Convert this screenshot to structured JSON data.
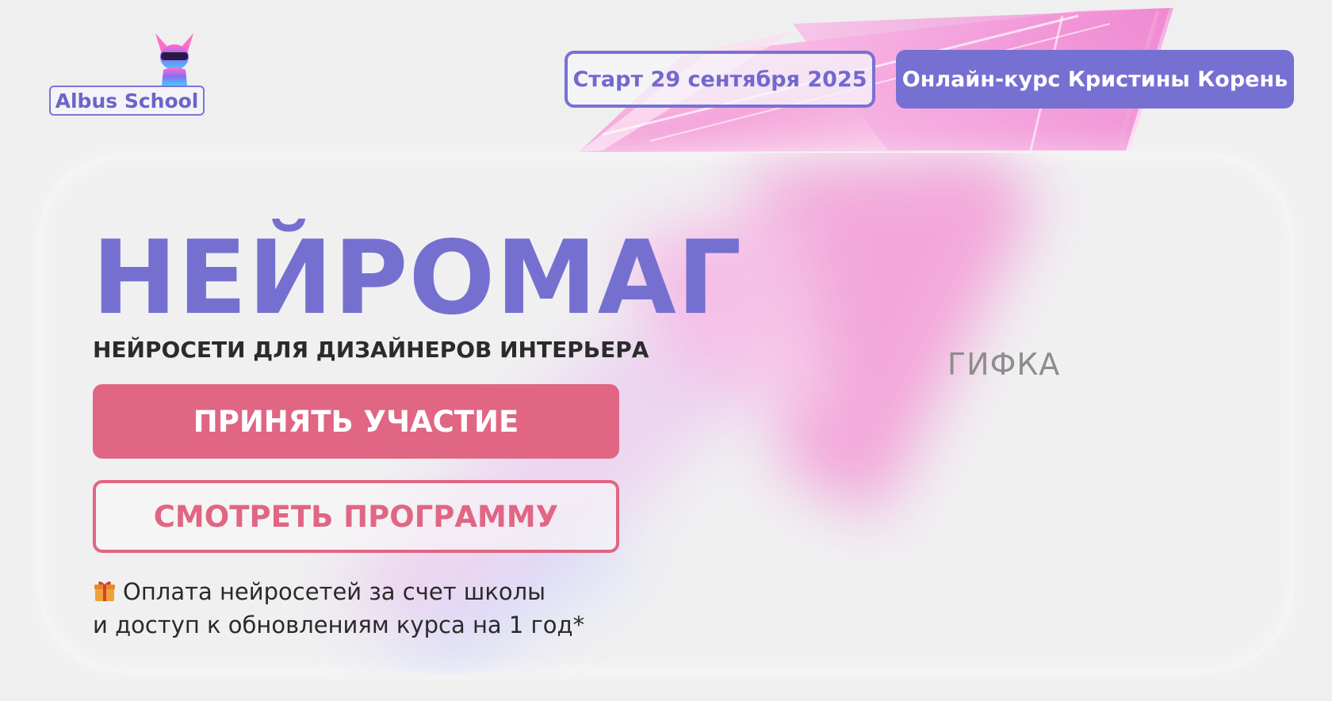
{
  "logo": {
    "text": "Albus School",
    "icon": "sphynx-cat-vr-icon"
  },
  "header": {
    "start_label": "Старт 29 сентября 2025",
    "author_label": "Онлайн-курс Кристины Корень"
  },
  "hero": {
    "title": "НЕЙРОМАГ",
    "subtitle": "НЕЙРОСЕТИ ДЛЯ ДИЗАЙНЕРОВ ИНТЕРЬЕРА",
    "cta_primary": "ПРИНЯТЬ УЧАСТИЕ",
    "cta_secondary": "СМОТРЕТЬ ПРОГРАММУ",
    "bonus_line1": "Оплата нейросетей за счет школы",
    "bonus_line2": "и доступ к обновлениям курса на 1 год*",
    "bonus_icon": "gift-icon",
    "media_placeholder": "ГИФКА"
  },
  "colors": {
    "accent_purple": "#7570d0",
    "accent_pink": "#e06683",
    "background": "#efefef"
  }
}
